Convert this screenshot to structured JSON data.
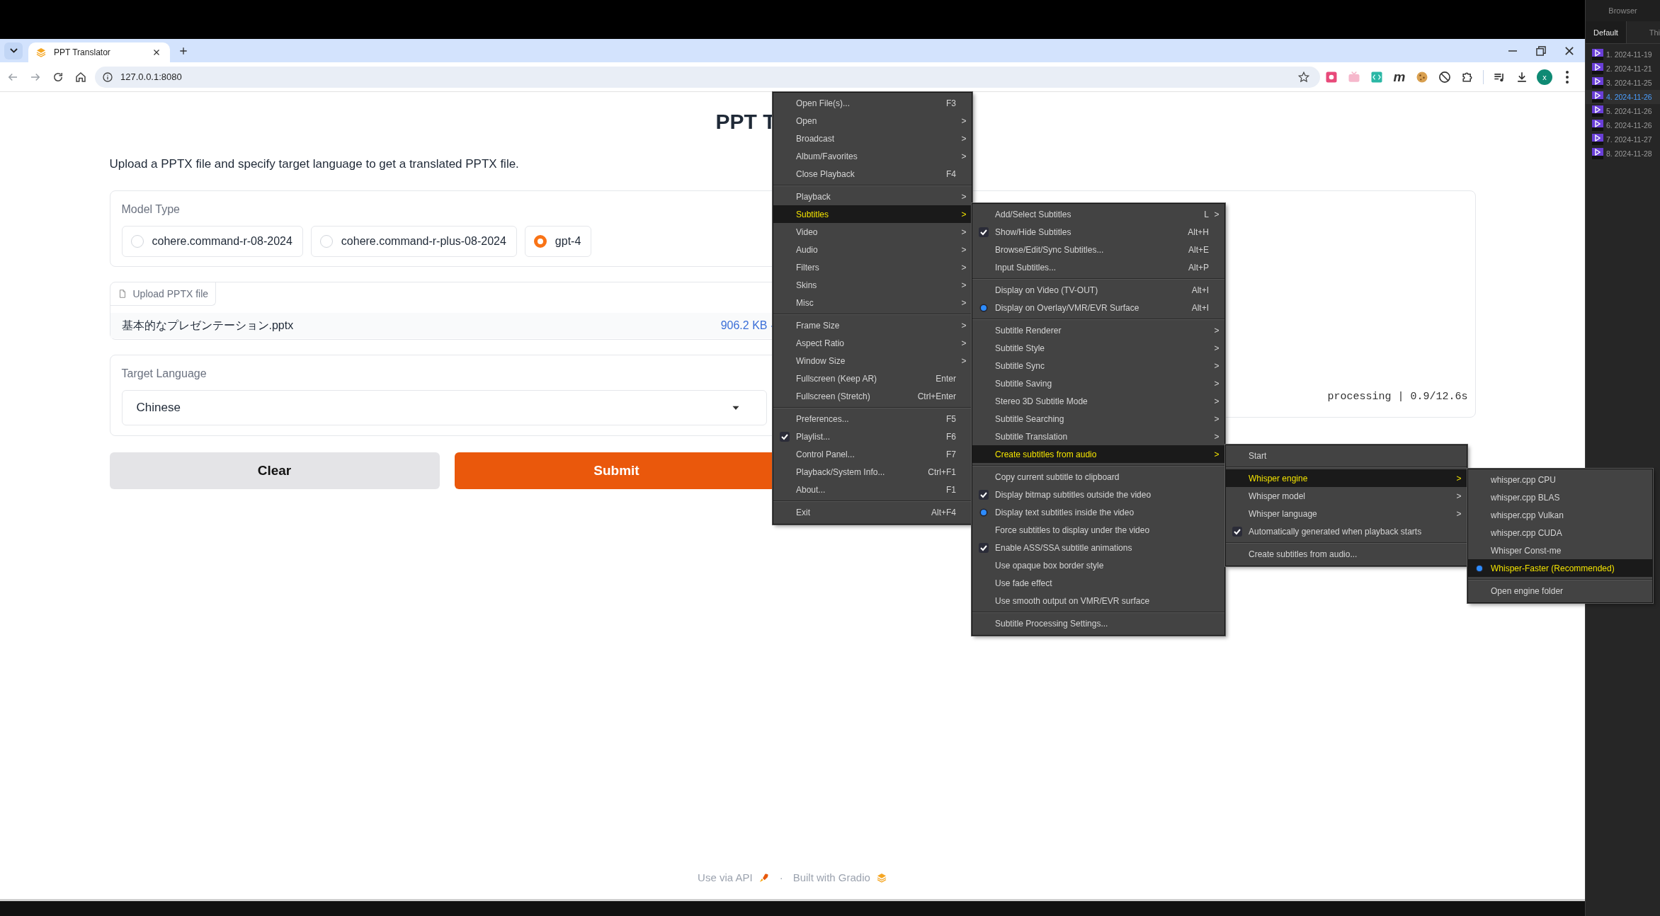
{
  "browser": {
    "tab": {
      "title": "PPT Translator"
    },
    "address": "127.0.0.1:8080",
    "extension_letter": "m",
    "profile_initial": "x"
  },
  "page": {
    "title": "PPT T",
    "description": "Upload a PPTX file and specify target language to get a translated PPTX file.",
    "model_type": {
      "label": "Model Type",
      "options": [
        {
          "label": "cohere.command-r-08-2024",
          "selected": false
        },
        {
          "label": "cohere.command-r-plus-08-2024",
          "selected": false
        },
        {
          "label": "gpt-4",
          "selected": true
        }
      ]
    },
    "upload": {
      "label": "Upload PPTX file",
      "file_name": "基本的なプレゼンテーション.pptx",
      "file_size": "906.2 KB"
    },
    "target_language": {
      "label": "Target Language",
      "value": "Chinese"
    },
    "buttons": [
      {
        "label": "Clear",
        "kind": "secondary"
      },
      {
        "label": "Submit",
        "kind": "primary"
      }
    ],
    "output": {
      "status": "processing | 0.9/12.6s"
    },
    "footer": {
      "api_link": "Use via API",
      "separator": "·",
      "built_with": "Built with Gradio"
    }
  },
  "context_menus": [
    {
      "groups": [
        [
          {
            "label": "Open File(s)...",
            "shortcut": "F3",
            "checked": false,
            "selected": false
          },
          {
            "label": "Open",
            "arrow": ">",
            "checked": false,
            "selected": false
          },
          {
            "label": "Broadcast",
            "arrow": ">",
            "checked": false,
            "selected": false
          },
          {
            "label": "Album/Favorites",
            "arrow": ">",
            "checked": false,
            "selected": false
          },
          {
            "label": "Close Playback",
            "shortcut": "F4",
            "checked": false,
            "selected": false
          }
        ],
        [
          {
            "label": "Playback",
            "arrow": ">",
            "checked": false,
            "selected": false
          },
          {
            "label": "Subtitles",
            "arrow": ">",
            "checked": false,
            "selected": true
          },
          {
            "label": "Video",
            "arrow": ">",
            "checked": false,
            "selected": false
          },
          {
            "label": "Audio",
            "arrow": ">",
            "checked": false,
            "selected": false
          },
          {
            "label": "Filters",
            "arrow": ">",
            "checked": false,
            "selected": false
          },
          {
            "label": "Skins",
            "arrow": ">",
            "checked": false,
            "selected": false
          },
          {
            "label": "Misc",
            "arrow": ">",
            "checked": false,
            "selected": false
          }
        ],
        [
          {
            "label": "Frame Size",
            "arrow": ">",
            "checked": false,
            "selected": false
          },
          {
            "label": "Aspect Ratio",
            "arrow": ">",
            "checked": false,
            "selected": false
          },
          {
            "label": "Window Size",
            "arrow": ">",
            "checked": false,
            "selected": false
          },
          {
            "label": "Fullscreen (Keep AR)",
            "shortcut": "Enter",
            "checked": false,
            "selected": false
          },
          {
            "label": "Fullscreen (Stretch)",
            "shortcut": "Ctrl+Enter",
            "checked": false,
            "selected": false
          }
        ],
        [
          {
            "label": "Preferences...",
            "shortcut": "F5",
            "checked": false,
            "selected": false
          },
          {
            "kind": "check",
            "label": "Playlist...",
            "shortcut": "F6",
            "checked": true,
            "selected": false
          },
          {
            "label": "Control Panel...",
            "shortcut": "F7",
            "checked": false,
            "selected": false
          },
          {
            "label": "Playback/System Info...",
            "shortcut": "Ctrl+F1",
            "checked": false,
            "selected": false
          },
          {
            "label": "About...",
            "shortcut": "F1",
            "checked": false,
            "selected": false
          }
        ],
        [
          {
            "label": "Exit",
            "shortcut": "Alt+F4",
            "checked": false,
            "selected": false
          }
        ]
      ]
    },
    {
      "groups": [
        [
          {
            "label": "Add/Select Subtitles",
            "shortcut": "L",
            "arrow": ">",
            "checked": false,
            "selected": false
          },
          {
            "kind": "check",
            "label": "Show/Hide Subtitles",
            "shortcut": "Alt+H",
            "checked": true,
            "selected": false
          },
          {
            "label": "Browse/Edit/Sync Subtitles...",
            "shortcut": "Alt+E",
            "checked": false,
            "selected": false
          },
          {
            "label": "Input Subtitles...",
            "shortcut": "Alt+P",
            "checked": false,
            "selected": false
          }
        ],
        [
          {
            "label": "Display on Video (TV-OUT)",
            "shortcut": "Alt+I",
            "checked": false,
            "selected": false
          },
          {
            "kind": "radio",
            "label": "Display on Overlay/VMR/EVR Surface",
            "shortcut": "Alt+I",
            "checked": true,
            "selected": false
          }
        ],
        [
          {
            "label": "Subtitle Renderer",
            "arrow": ">",
            "checked": false,
            "selected": false
          },
          {
            "label": "Subtitle Style",
            "arrow": ">",
            "checked": false,
            "selected": false
          },
          {
            "label": "Subtitle Sync",
            "arrow": ">",
            "checked": false,
            "selected": false
          },
          {
            "label": "Subtitle Saving",
            "arrow": ">",
            "checked": false,
            "selected": false
          },
          {
            "label": "Stereo 3D Subtitle Mode",
            "arrow": ">",
            "checked": false,
            "selected": false
          },
          {
            "label": "Subtitle Searching",
            "arrow": ">",
            "checked": false,
            "selected": false
          },
          {
            "label": "Subtitle Translation",
            "arrow": ">",
            "checked": false,
            "selected": false
          },
          {
            "label": "Create subtitles from audio",
            "arrow": ">",
            "checked": false,
            "selected": true
          }
        ],
        [
          {
            "label": "Copy current subtitle to clipboard",
            "checked": false,
            "selected": false
          },
          {
            "kind": "check",
            "label": "Display bitmap subtitles outside the video",
            "checked": true,
            "selected": false
          },
          {
            "kind": "radio",
            "label": "Display text subtitles inside the video",
            "checked": true,
            "selected": false
          },
          {
            "label": "Force subtitles to display under the video",
            "checked": false,
            "selected": false
          },
          {
            "kind": "check",
            "label": "Enable ASS/SSA subtitle animations",
            "checked": true,
            "selected": false
          },
          {
            "label": "Use opaque box border style",
            "checked": false,
            "selected": false
          },
          {
            "label": "Use fade effect",
            "checked": false,
            "selected": false
          },
          {
            "label": "Use smooth output on VMR/EVR surface",
            "checked": false,
            "selected": false
          }
        ],
        [
          {
            "label": "Subtitle Processing Settings...",
            "checked": false,
            "selected": false
          }
        ]
      ]
    },
    {
      "groups": [
        [
          {
            "label": "Start",
            "checked": false,
            "selected": false
          }
        ],
        [
          {
            "label": "Whisper engine",
            "arrow": ">",
            "checked": false,
            "selected": true
          },
          {
            "label": "Whisper model",
            "arrow": ">",
            "checked": false,
            "selected": false
          },
          {
            "label": "Whisper language",
            "arrow": ">",
            "checked": false,
            "selected": false
          },
          {
            "kind": "check",
            "label": "Automatically generated when playback starts",
            "checked": true,
            "selected": false
          }
        ],
        [
          {
            "label": "Create subtitles from audio...",
            "checked": false,
            "selected": false
          }
        ]
      ]
    },
    {
      "groups": [
        [
          {
            "label": "whisper.cpp CPU",
            "checked": false,
            "selected": false
          },
          {
            "label": "whisper.cpp BLAS",
            "checked": false,
            "selected": false
          },
          {
            "label": "whisper.cpp Vulkan",
            "checked": false,
            "selected": false
          },
          {
            "label": "whisper.cpp CUDA",
            "checked": false,
            "selected": false
          },
          {
            "label": "Whisper Const-me",
            "checked": false,
            "selected": false
          },
          {
            "kind": "radio",
            "label": "Whisper-Faster (Recommended)",
            "checked": true,
            "selected": true
          }
        ],
        [
          {
            "label": "Open engine folder",
            "checked": false,
            "selected": false
          }
        ]
      ]
    }
  ],
  "playlist_panel": {
    "title": "Browser",
    "tabs": [
      {
        "label": "Default",
        "selected": true
      },
      {
        "label": "Thi",
        "selected": false
      }
    ],
    "items": [
      {
        "label": "1. 2024-11-19",
        "selected": false
      },
      {
        "label": "2. 2024-11-21",
        "selected": false
      },
      {
        "label": "3. 2024-11-25",
        "selected": false
      },
      {
        "label": "4. 2024-11-26",
        "selected": true
      },
      {
        "label": "5. 2024-11-26",
        "selected": false
      },
      {
        "label": "6. 2024-11-26",
        "selected": false
      },
      {
        "label": "7. 2024-11-27",
        "selected": false
      },
      {
        "label": "8. 2024-11-28",
        "selected": false
      }
    ]
  }
}
